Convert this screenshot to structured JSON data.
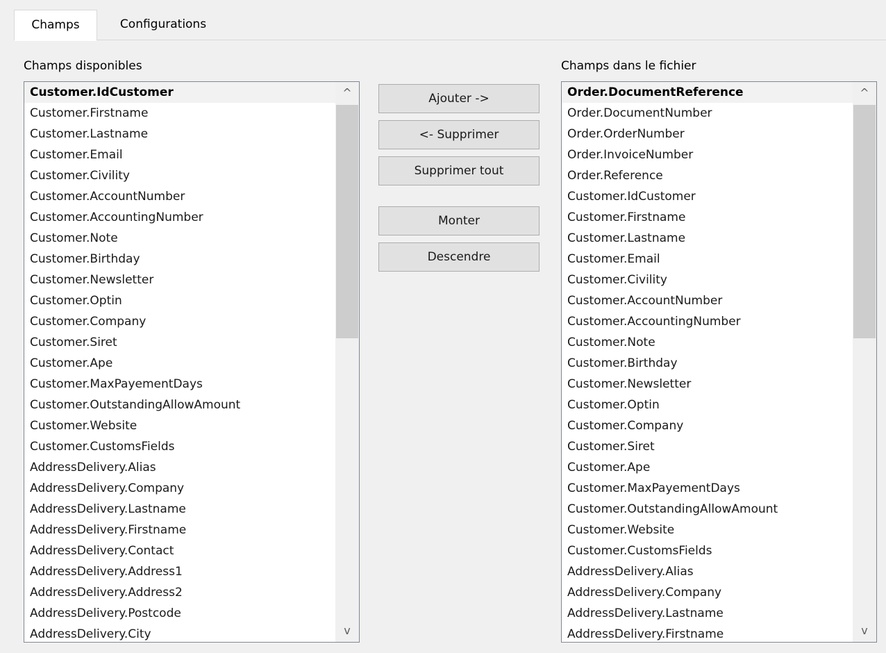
{
  "tabs": [
    {
      "label": "Champs"
    },
    {
      "label": "Configurations"
    }
  ],
  "available": {
    "label": "Champs disponibles",
    "items": [
      "Customer.IdCustomer",
      "Customer.Firstname",
      "Customer.Lastname",
      "Customer.Email",
      "Customer.Civility",
      "Customer.AccountNumber",
      "Customer.AccountingNumber",
      "Customer.Note",
      "Customer.Birthday",
      "Customer.Newsletter",
      "Customer.Optin",
      "Customer.Company",
      "Customer.Siret",
      "Customer.Ape",
      "Customer.MaxPayementDays",
      "Customer.OutstandingAllowAmount",
      "Customer.Website",
      "Customer.CustomsFields",
      "AddressDelivery.Alias",
      "AddressDelivery.Company",
      "AddressDelivery.Lastname",
      "AddressDelivery.Firstname",
      "AddressDelivery.Contact",
      "AddressDelivery.Address1",
      "AddressDelivery.Address2",
      "AddressDelivery.Postcode",
      "AddressDelivery.City"
    ],
    "selected_index": 0,
    "scroll": {
      "up_icon": "^",
      "down_icon": "v"
    }
  },
  "file": {
    "label": "Champs dans le fichier",
    "items": [
      "Order.DocumentReference",
      "Order.DocumentNumber",
      "Order.OrderNumber",
      "Order.InvoiceNumber",
      "Order.Reference",
      "Customer.IdCustomer",
      "Customer.Firstname",
      "Customer.Lastname",
      "Customer.Email",
      "Customer.Civility",
      "Customer.AccountNumber",
      "Customer.AccountingNumber",
      "Customer.Note",
      "Customer.Birthday",
      "Customer.Newsletter",
      "Customer.Optin",
      "Customer.Company",
      "Customer.Siret",
      "Customer.Ape",
      "Customer.MaxPayementDays",
      "Customer.OutstandingAllowAmount",
      "Customer.Website",
      "Customer.CustomsFields",
      "AddressDelivery.Alias",
      "AddressDelivery.Company",
      "AddressDelivery.Lastname",
      "AddressDelivery.Firstname"
    ],
    "selected_index": 0,
    "scroll": {
      "up_icon": "^",
      "down_icon": "v"
    }
  },
  "buttons": {
    "add": "Ajouter ->",
    "remove": "<- Supprimer",
    "remove_all": "Supprimer tout",
    "up": "Monter",
    "down": "Descendre"
  }
}
